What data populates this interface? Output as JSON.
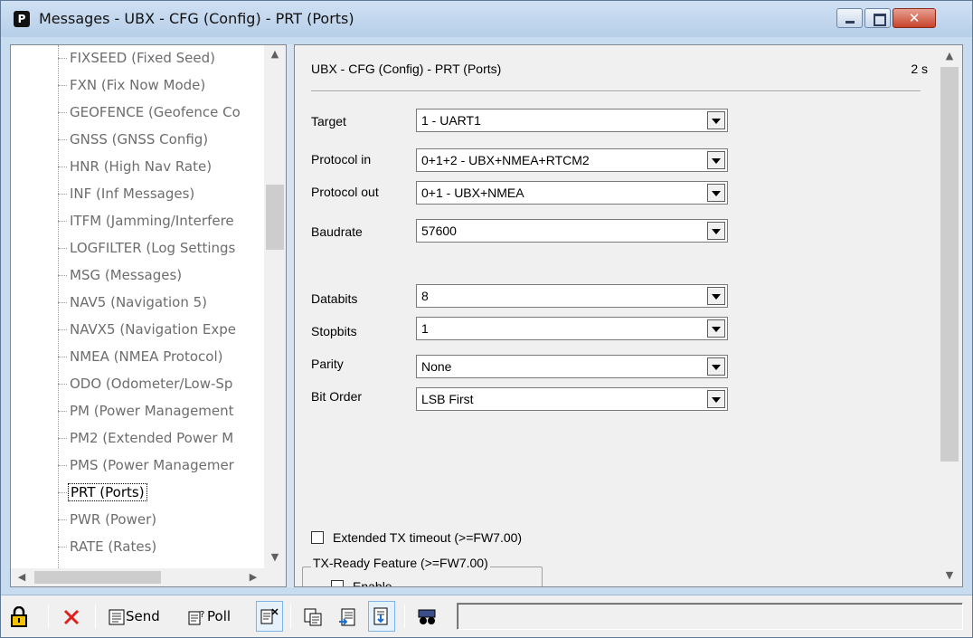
{
  "window": {
    "title": "Messages - UBX - CFG (Config) - PRT (Ports)",
    "app_icon": "P"
  },
  "tree": {
    "items": [
      {
        "label": "FIXSEED (Fixed Seed)"
      },
      {
        "label": "FXN (Fix Now Mode)"
      },
      {
        "label": "GEOFENCE (Geofence Co"
      },
      {
        "label": "GNSS (GNSS Config)"
      },
      {
        "label": "HNR (High Nav Rate)"
      },
      {
        "label": "INF (Inf Messages)"
      },
      {
        "label": "ITFM (Jamming/Interfere"
      },
      {
        "label": "LOGFILTER (Log Settings"
      },
      {
        "label": "MSG (Messages)"
      },
      {
        "label": "NAV5 (Navigation 5)"
      },
      {
        "label": "NAVX5 (Navigation Expe"
      },
      {
        "label": "NMEA (NMEA Protocol)"
      },
      {
        "label": "ODO (Odometer/Low-Sp"
      },
      {
        "label": "PM (Power Management"
      },
      {
        "label": "PM2 (Extended Power M"
      },
      {
        "label": "PMS (Power Managemer"
      },
      {
        "label": "PRT (Ports)",
        "selected": true
      },
      {
        "label": "PWR (Power)"
      },
      {
        "label": "RATE (Rates)"
      }
    ],
    "selected": "PRT (Ports)"
  },
  "panel": {
    "title": "UBX - CFG (Config) - PRT (Ports)",
    "elapsed": "2 s",
    "fields": {
      "target": {
        "label": "Target",
        "value": "1 - UART1"
      },
      "protocol_in": {
        "label": "Protocol in",
        "value": "0+1+2 - UBX+NMEA+RTCM2"
      },
      "protocol_out": {
        "label": "Protocol out",
        "value": "0+1 - UBX+NMEA"
      },
      "baudrate": {
        "label": "Baudrate",
        "value": "57600"
      },
      "databits": {
        "label": "Databits",
        "value": "8"
      },
      "stopbits": {
        "label": "Stopbits",
        "value": "1"
      },
      "parity": {
        "label": "Parity",
        "value": "None"
      },
      "bit_order": {
        "label": "Bit Order",
        "value": "LSB First"
      }
    },
    "extended_tx_timeout": {
      "label": "Extended TX timeout (>=FW7.00)",
      "checked": false
    },
    "tx_ready": {
      "group_label": "TX-Ready Feature (>=FW7.00)",
      "enable_label": "Enable",
      "checked": false
    }
  },
  "toolbar": {
    "lock_icon": "lock-icon",
    "delete_icon": "red-x-icon",
    "send_label": "Send",
    "poll_label": "Poll",
    "status_text": ""
  },
  "colors": {
    "title_bar": "#c8dcf0",
    "close_button": "#c7432b",
    "delete_red": "#e0201b",
    "lock_yellow": "#f2c200"
  }
}
